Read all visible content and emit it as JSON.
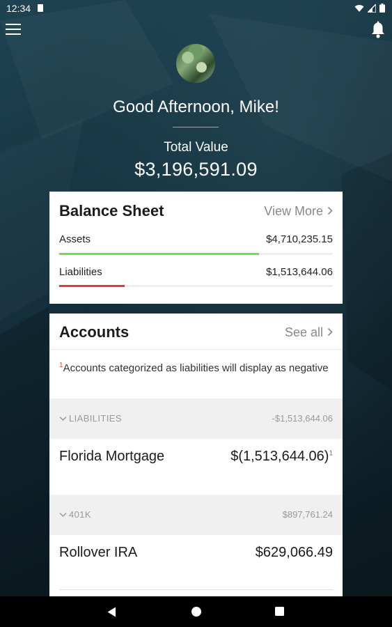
{
  "status_bar": {
    "time": "12:34"
  },
  "header": {
    "greeting": "Good Afternoon, Mike!",
    "total_label": "Total Value",
    "total_value": "$3,196,591.09"
  },
  "balance_sheet": {
    "title": "Balance Sheet",
    "link": "View More",
    "rows": [
      {
        "label": "Assets",
        "value": "$4,710,235.15",
        "fill_fraction": 0.73,
        "color": "#6ee04a"
      },
      {
        "label": "Liabilities",
        "value": "$1,513,644.06",
        "fill_fraction": 0.24,
        "color": "#e53935"
      }
    ]
  },
  "accounts": {
    "title": "Accounts",
    "link": "See all",
    "note_marker": "1",
    "note": "Accounts categorized as liabilities will display as negative",
    "groups": [
      {
        "label": "LIABILITIES",
        "total": "-$1,513,644.06",
        "account": {
          "name": "Florida Mortgage",
          "value": "$(1,513,644.06)",
          "marker": "1"
        }
      },
      {
        "label": "401K",
        "total": "$897,761.24",
        "account": {
          "name": "Rollover IRA",
          "value": "$629,066.49",
          "marker": ""
        }
      }
    ]
  },
  "icons": {
    "menu": "hamburger-menu-icon",
    "bell": "bell-icon",
    "back": "back-triangle-icon",
    "home": "home-circle-icon",
    "recents": "recents-square-icon"
  }
}
